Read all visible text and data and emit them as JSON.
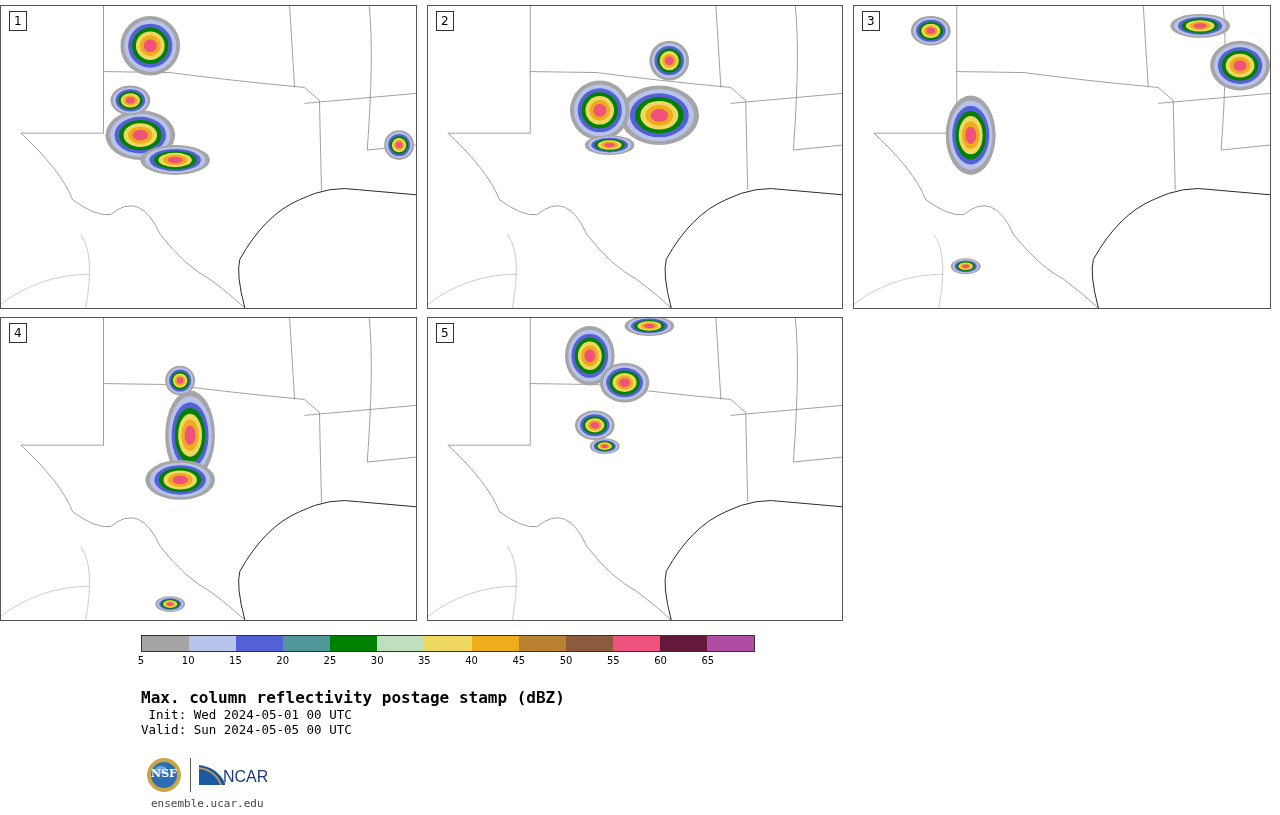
{
  "panels": [
    {
      "label": "1"
    },
    {
      "label": "2"
    },
    {
      "label": "3"
    },
    {
      "label": "4"
    },
    {
      "label": "5"
    }
  ],
  "colorbar": {
    "bins": [
      {
        "color": "#a5a5a5"
      },
      {
        "color": "#b8c3ec"
      },
      {
        "color": "#5460d5"
      },
      {
        "color": "#50979a"
      },
      {
        "color": "#008000"
      },
      {
        "color": "#bfdfbf"
      },
      {
        "color": "#efd860"
      },
      {
        "color": "#efad1b"
      },
      {
        "color": "#b88230"
      },
      {
        "color": "#8c5a3c"
      },
      {
        "color": "#f0527e"
      },
      {
        "color": "#631a3a"
      },
      {
        "color": "#b04ca4"
      }
    ],
    "ticks": [
      "5",
      "10",
      "15",
      "20",
      "25",
      "30",
      "35",
      "40",
      "45",
      "50",
      "55",
      "60",
      "65"
    ]
  },
  "title": "Max. column reflectivity postage stamp (dBZ)",
  "info_lines": [
    " Init: Wed 2024-05-01 00 UTC",
    "Valid: Sun 2024-05-05 00 UTC"
  ],
  "logos": {
    "nsf": "NSF",
    "ncar": "NCAR"
  },
  "website": "ensemble.ucar.edu"
}
